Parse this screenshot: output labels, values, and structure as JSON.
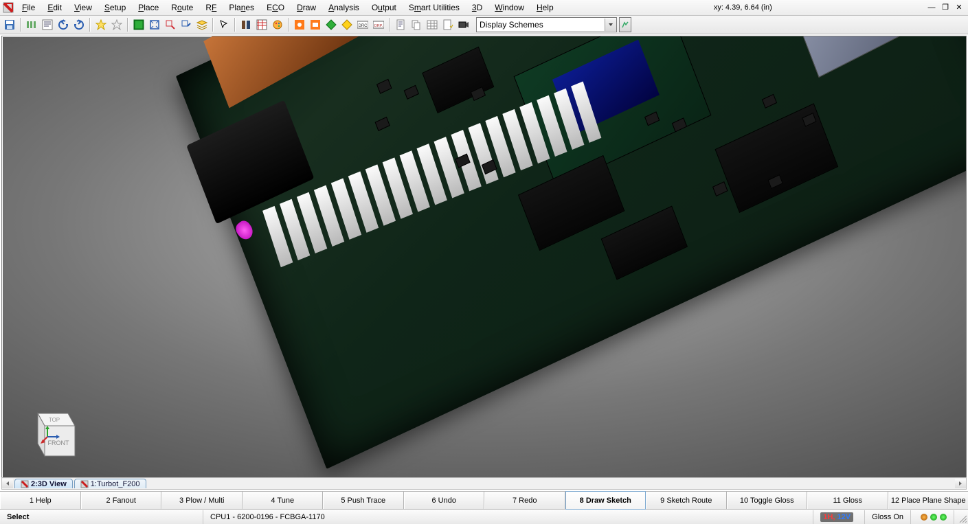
{
  "app_icon": "app-icon",
  "menus": [
    "File",
    "Edit",
    "View",
    "Setup",
    "Place",
    "Route",
    "RF",
    "Planes",
    "ECO",
    "Draw",
    "Analysis",
    "Output",
    "Smart Utilities",
    "3D",
    "Window",
    "Help"
  ],
  "coord_label": "xy: 4.39, 6.64 (in)",
  "toolbar": {
    "display_schemes": "Display Schemes"
  },
  "tabs": {
    "active": "2:3D View",
    "inactive": "1:Turbot_F200"
  },
  "viewcube": {
    "top": "TOP",
    "front": "FRONT"
  },
  "fn_buttons": [
    {
      "label": "1 Help",
      "active": false
    },
    {
      "label": "2 Fanout",
      "active": false
    },
    {
      "label": "3 Plow / Multi",
      "active": false
    },
    {
      "label": "4 Tune",
      "active": false
    },
    {
      "label": "5 Push Trace",
      "active": false
    },
    {
      "label": "6 Undo",
      "active": false
    },
    {
      "label": "7 Redo",
      "active": false
    },
    {
      "label": "8 Draw Sketch",
      "active": true
    },
    {
      "label": "9 Sketch Route",
      "active": false
    },
    {
      "label": "10 Toggle Gloss",
      "active": false
    },
    {
      "label": "11 Gloss",
      "active": false
    },
    {
      "label": "12 Place Plane Shape",
      "active": false
    }
  ],
  "status": {
    "mode": "Select",
    "component": "CPU1 - 6200-0196 - FCBGA-1170",
    "layer_h": "1H,",
    "layer_v": "12V",
    "gloss": "Gloss On"
  }
}
